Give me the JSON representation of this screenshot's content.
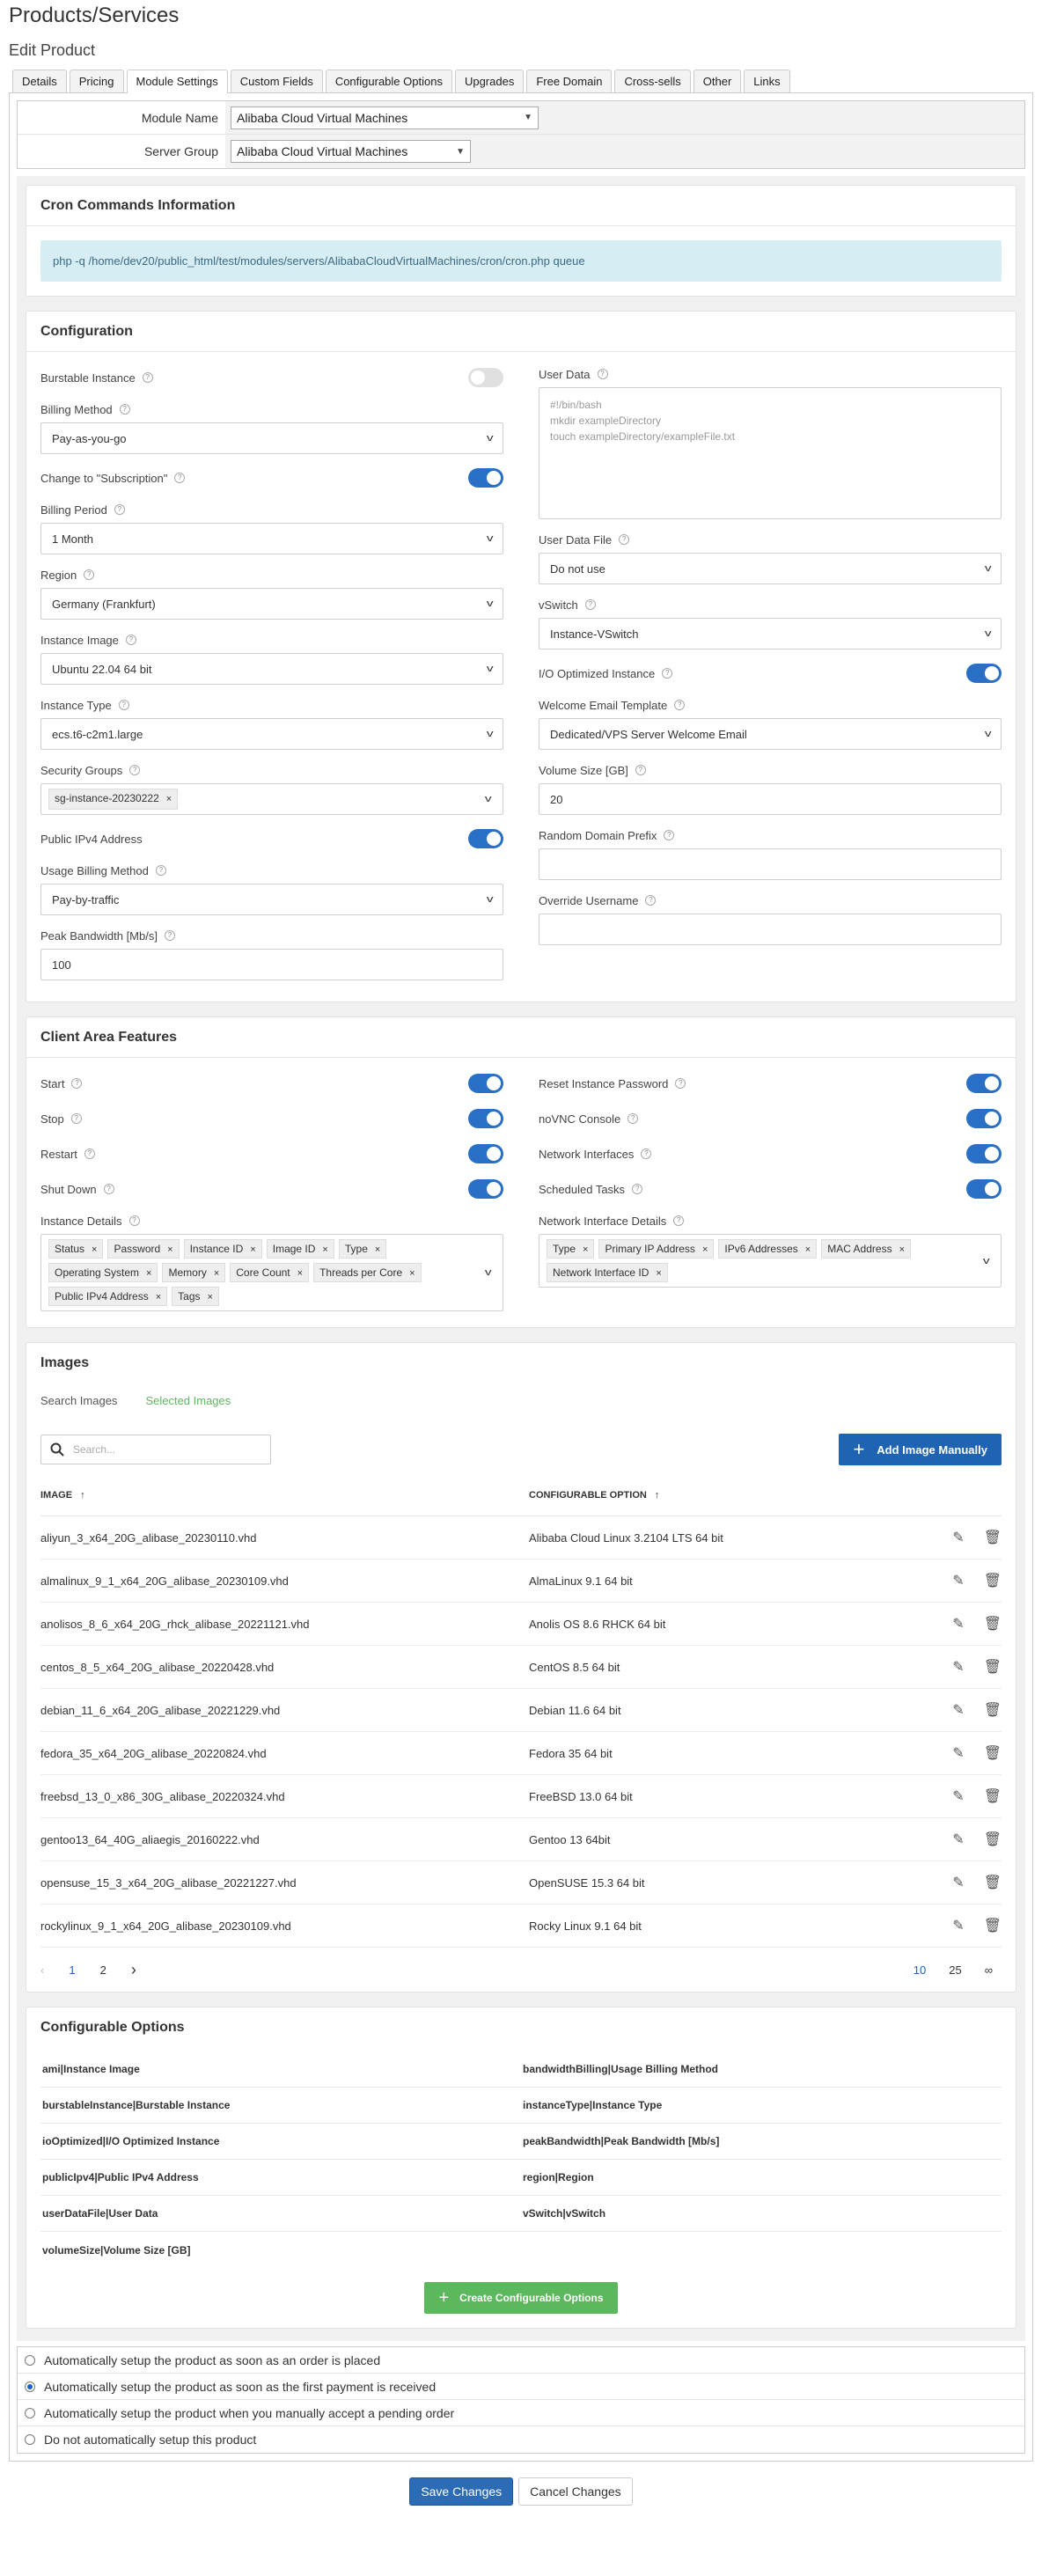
{
  "page": {
    "title": "Products/Services",
    "subtitle": "Edit Product"
  },
  "tabs": [
    "Details",
    "Pricing",
    "Module Settings",
    "Custom Fields",
    "Configurable Options",
    "Upgrades",
    "Free Domain",
    "Cross-sells",
    "Other",
    "Links"
  ],
  "module": {
    "module_name_label": "Module Name",
    "module_name_value": "Alibaba Cloud Virtual Machines",
    "server_group_label": "Server Group",
    "server_group_value": "Alibaba Cloud Virtual Machines"
  },
  "cron": {
    "title": "Cron Commands Information",
    "command": "php -q /home/dev20/public_html/test/modules/servers/AlibabaCloudVirtualMachines/cron/cron.php queue"
  },
  "config": {
    "title": "Configuration",
    "burstable_label": "Burstable Instance",
    "billing_method_label": "Billing Method",
    "billing_method_value": "Pay-as-you-go",
    "change_sub_label": "Change to \"Subscription\"",
    "billing_period_label": "Billing Period",
    "billing_period_value": "1 Month",
    "region_label": "Region",
    "region_value": "Germany (Frankfurt)",
    "instance_image_label": "Instance Image",
    "instance_image_value": "Ubuntu 22.04 64 bit",
    "instance_type_label": "Instance Type",
    "instance_type_value": "ecs.t6-c2m1.large",
    "security_groups_label": "Security Groups",
    "security_group_tag": "sg-instance-20230222",
    "public_ipv4_label": "Public IPv4 Address",
    "usage_billing_label": "Usage Billing Method",
    "usage_billing_value": "Pay-by-traffic",
    "peak_bandwidth_label": "Peak Bandwidth [Mb/s]",
    "peak_bandwidth_value": "100",
    "user_data_label": "User Data",
    "user_data_line1": "#!/bin/bash",
    "user_data_line2": "mkdir exampleDirectory",
    "user_data_line3": "touch exampleDirectory/exampleFile.txt",
    "user_data_file_label": "User Data File",
    "user_data_file_value": "Do not use",
    "vswitch_label": "vSwitch",
    "vswitch_value": "Instance-VSwitch",
    "io_optimized_label": "I/O Optimized Instance",
    "welcome_email_label": "Welcome Email Template",
    "welcome_email_value": "Dedicated/VPS Server Welcome Email",
    "volume_size_label": "Volume Size [GB]",
    "volume_size_value": "20",
    "random_prefix_label": "Random Domain Prefix",
    "override_username_label": "Override Username"
  },
  "client_area": {
    "title": "Client Area Features",
    "start": "Start",
    "stop": "Stop",
    "restart": "Restart",
    "shutdown": "Shut Down",
    "reset_password": "Reset Instance Password",
    "novnc": "noVNC Console",
    "net_ifaces": "Network Interfaces",
    "sched_tasks": "Scheduled Tasks",
    "instance_details_label": "Instance Details",
    "instance_details_tags": [
      "Status",
      "Password",
      "Instance ID",
      "Image ID",
      "Type",
      "Operating System",
      "Memory",
      "Core Count",
      "Threads per Core",
      "Public IPv4 Address",
      "Tags"
    ],
    "net_details_label": "Network Interface Details",
    "net_details_tags": [
      "Type",
      "Primary IP Address",
      "IPv6 Addresses",
      "MAC Address",
      "Network Interface ID"
    ]
  },
  "images": {
    "title": "Images",
    "tab_search": "Search Images",
    "tab_selected": "Selected Images",
    "search_placeholder": "Search...",
    "add_button": "Add Image Manually",
    "col_image": "IMAGE",
    "col_option": "CONFIGURABLE OPTION",
    "rows": [
      {
        "image": "aliyun_3_x64_20G_alibase_20230110.vhd",
        "option": "Alibaba Cloud Linux 3.2104 LTS 64 bit"
      },
      {
        "image": "almalinux_9_1_x64_20G_alibase_20230109.vhd",
        "option": "AlmaLinux 9.1 64 bit"
      },
      {
        "image": "anolisos_8_6_x64_20G_rhck_alibase_20221121.vhd",
        "option": "Anolis OS 8.6 RHCK 64 bit"
      },
      {
        "image": "centos_8_5_x64_20G_alibase_20220428.vhd",
        "option": "CentOS 8.5 64 bit"
      },
      {
        "image": "debian_11_6_x64_20G_alibase_20221229.vhd",
        "option": "Debian 11.6 64 bit"
      },
      {
        "image": "fedora_35_x64_20G_alibase_20220824.vhd",
        "option": "Fedora 35 64 bit"
      },
      {
        "image": "freebsd_13_0_x86_30G_alibase_20220324.vhd",
        "option": "FreeBSD 13.0 64 bit"
      },
      {
        "image": "gentoo13_64_40G_aliaegis_20160222.vhd",
        "option": "Gentoo 13 64bit"
      },
      {
        "image": "opensuse_15_3_x64_20G_alibase_20221227.vhd",
        "option": "OpenSUSE 15.3 64 bit"
      },
      {
        "image": "rockylinux_9_1_x64_20G_alibase_20230109.vhd",
        "option": "Rocky Linux 9.1 64 bit"
      }
    ],
    "pages": [
      "1",
      "2"
    ],
    "page_sizes": [
      "10",
      "25",
      "∞"
    ]
  },
  "conf_options": {
    "title": "Configurable Options",
    "rows": [
      [
        "ami|Instance Image",
        "bandwidthBilling|Usage Billing Method"
      ],
      [
        "burstableInstance|Burstable Instance",
        "instanceType|Instance Type"
      ],
      [
        "ioOptimized|I/O Optimized Instance",
        "peakBandwidth|Peak Bandwidth [Mb/s]"
      ],
      [
        "publicIpv4|Public IPv4 Address",
        "region|Region"
      ],
      [
        "userDataFile|User Data",
        "vSwitch|vSwitch"
      ],
      [
        "volumeSize|Volume Size [GB]",
        ""
      ]
    ],
    "create_button": "Create Configurable Options"
  },
  "setup": [
    "Automatically setup the product as soon as an order is placed",
    "Automatically setup the product as soon as the first payment is received",
    "Automatically setup the product when you manually accept a pending order",
    "Do not automatically setup this product"
  ],
  "buttons": {
    "save": "Save Changes",
    "cancel": "Cancel Changes"
  }
}
